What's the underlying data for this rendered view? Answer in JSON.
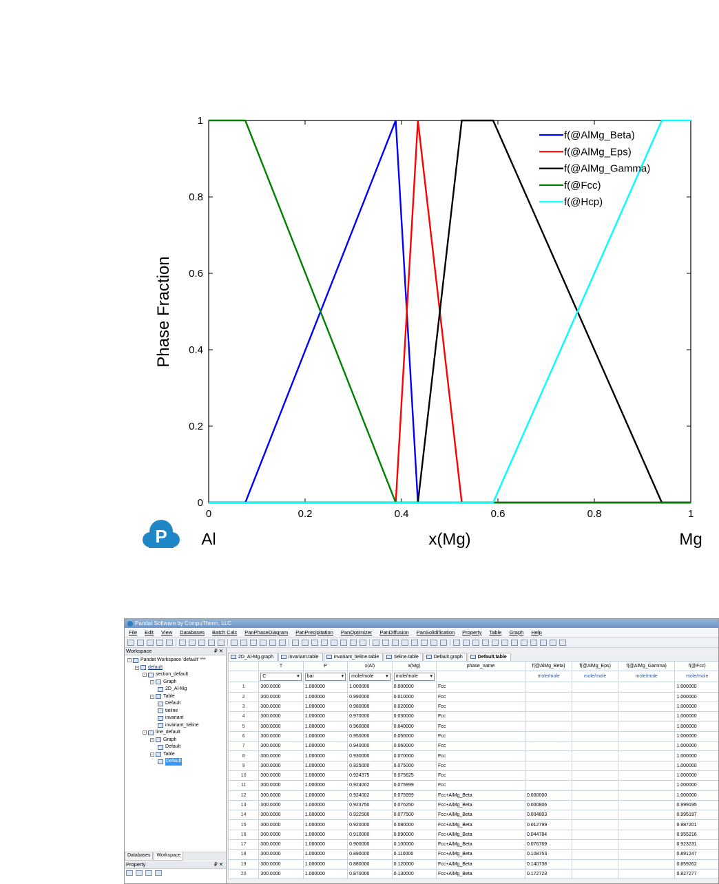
{
  "chart_data": {
    "type": "line",
    "xlabel": "x(Mg)",
    "ylabel": "Phase Fraction",
    "xlim": [
      0,
      1
    ],
    "ylim": [
      0,
      1
    ],
    "x_ticks": [
      "0",
      "0.2",
      "0.4",
      "0.6",
      "0.8",
      "1"
    ],
    "y_ticks": [
      "0",
      "0.2",
      "0.4",
      "0.6",
      "0.8",
      "1"
    ],
    "x_end_labels": {
      "left": "Al",
      "right": "Mg"
    },
    "legend_placement": "top-right",
    "grid": false,
    "series": [
      {
        "name": "f(@AlMg_Beta)",
        "color": "#0000ff",
        "x": [
          0,
          0.076,
          0.388,
          0.434,
          1
        ],
        "y": [
          0,
          0,
          1,
          0,
          0
        ]
      },
      {
        "name": "f(@AlMg_Eps)",
        "color": "#ff0000",
        "x": [
          0,
          0.388,
          0.434,
          0.525,
          1
        ],
        "y": [
          0,
          0,
          1,
          0,
          0
        ]
      },
      {
        "name": "f(@AlMg_Gamma)",
        "color": "#000000",
        "x": [
          0,
          0.434,
          0.525,
          0.59,
          0.94,
          1
        ],
        "y": [
          0,
          0,
          1,
          1,
          0,
          0
        ]
      },
      {
        "name": "f(@Fcc)",
        "color": "#008000",
        "x": [
          0,
          0.076,
          0.388,
          1
        ],
        "y": [
          1,
          1,
          0,
          0
        ]
      },
      {
        "name": "f(@Hcp)",
        "color": "#00ffff",
        "x": [
          0,
          0.59,
          0.94,
          1
        ],
        "y": [
          0,
          0,
          1,
          1
        ]
      }
    ]
  },
  "logo": {
    "letter": "P",
    "color": "#1f87c6"
  },
  "app": {
    "title": "Pandat Software by CompuTherm, LLC",
    "menu": [
      "File",
      "Edit",
      "View",
      "Databases",
      "Batch Calc",
      "PanPhaseDiagram",
      "PanPrecipitation",
      "PanOptimizer",
      "PanDiffusion",
      "PanSolidification",
      "Property",
      "Table",
      "Graph",
      "Help"
    ],
    "workspace_header": "Workspace",
    "pin_glyph": "₽ ✕",
    "tree": [
      {
        "label": "Pandat Workspace 'default' ***",
        "indent": 0,
        "expander": "-"
      },
      {
        "label": "default",
        "indent": 1,
        "expander": "-",
        "link": true
      },
      {
        "label": "section_default",
        "indent": 2,
        "expander": "-"
      },
      {
        "label": "Graph",
        "indent": 3,
        "expander": "-"
      },
      {
        "label": "2D_Al-Mg",
        "indent": 4,
        "expander": ""
      },
      {
        "label": "Table",
        "indent": 3,
        "expander": "-"
      },
      {
        "label": "Default",
        "indent": 4,
        "expander": ""
      },
      {
        "label": "tieline",
        "indent": 4,
        "expander": ""
      },
      {
        "label": "invariant",
        "indent": 4,
        "expander": ""
      },
      {
        "label": "invariant_tieline",
        "indent": 4,
        "expander": ""
      },
      {
        "label": "line_default",
        "indent": 2,
        "expander": "-"
      },
      {
        "label": "Graph",
        "indent": 3,
        "expander": "-"
      },
      {
        "label": "Default",
        "indent": 4,
        "expander": ""
      },
      {
        "label": "Table",
        "indent": 3,
        "expander": "-"
      },
      {
        "label": "Default",
        "indent": 4,
        "expander": "",
        "selected": true
      }
    ],
    "ws_tabs": [
      "Databases",
      "Workspace"
    ],
    "property_header": "Property",
    "doc_tabs": [
      "2D_Al-Mg.graph",
      "invariant.table",
      "invariant_tieline.table",
      "tieline.table",
      "Default.graph",
      "Default.table"
    ],
    "active_doc_tab": 5,
    "columns": [
      "T",
      "P",
      "x(Al)",
      "x(Mg)",
      "phase_name",
      "f(@AlMg_Beta)",
      "f(@AlMg_Eps)",
      "f(@AlMg_Gamma)",
      "f(@Fcc)"
    ],
    "unit_selects": [
      "C",
      "bar",
      "mole/mole",
      "mole/mole"
    ],
    "unit_texts": [
      "",
      "mole/mole",
      "mole/mole",
      "mole/mole",
      "mole/mole"
    ],
    "rows": [
      [
        "1",
        "300.0000",
        "1.000000",
        "1.000000",
        "0.000000",
        "Fcc",
        "",
        "",
        "",
        "1.000000"
      ],
      [
        "2",
        "300.0000",
        "1.000000",
        "0.990000",
        "0.010000",
        "Fcc",
        "",
        "",
        "",
        "1.000000"
      ],
      [
        "3",
        "300.0000",
        "1.000000",
        "0.980000",
        "0.020000",
        "Fcc",
        "",
        "",
        "",
        "1.000000"
      ],
      [
        "4",
        "300.0000",
        "1.000000",
        "0.970000",
        "0.030000",
        "Fcc",
        "",
        "",
        "",
        "1.000000"
      ],
      [
        "5",
        "300.0000",
        "1.000000",
        "0.960000",
        "0.040000",
        "Fcc",
        "",
        "",
        "",
        "1.000000"
      ],
      [
        "6",
        "300.0000",
        "1.000000",
        "0.950000",
        "0.050000",
        "Fcc",
        "",
        "",
        "",
        "1.000000"
      ],
      [
        "7",
        "300.0000",
        "1.000000",
        "0.940000",
        "0.060000",
        "Fcc",
        "",
        "",
        "",
        "1.000000"
      ],
      [
        "8",
        "300.0000",
        "1.000000",
        "0.930000",
        "0.070000",
        "Fcc",
        "",
        "",
        "",
        "1.000000"
      ],
      [
        "9",
        "300.0000",
        "1.000000",
        "0.925000",
        "0.075000",
        "Fcc",
        "",
        "",
        "",
        "1.000000"
      ],
      [
        "10",
        "300.0000",
        "1.000000",
        "0.924375",
        "0.075625",
        "Fcc",
        "",
        "",
        "",
        "1.000000"
      ],
      [
        "11",
        "300.0000",
        "1.000000",
        "0.924002",
        "0.075999",
        "Fcc",
        "",
        "",
        "",
        "1.000000"
      ],
      [
        "12",
        "300.0000",
        "1.000000",
        "0.924002",
        "0.075999",
        "Fcc+AlMg_Beta",
        "0.000000",
        "",
        "",
        "1.000000"
      ],
      [
        "13",
        "300.0000",
        "1.000000",
        "0.923750",
        "0.076250",
        "Fcc+AlMg_Beta",
        "0.000806",
        "",
        "",
        "0.999195"
      ],
      [
        "14",
        "300.0000",
        "1.000000",
        "0.922500",
        "0.077500",
        "Fcc+AlMg_Beta",
        "0.004803",
        "",
        "",
        "0.995197"
      ],
      [
        "15",
        "300.0000",
        "1.000000",
        "0.920000",
        "0.080000",
        "Fcc+AlMg_Beta",
        "0.012799",
        "",
        "",
        "0.987201"
      ],
      [
        "16",
        "300.0000",
        "1.000000",
        "0.910000",
        "0.090000",
        "Fcc+AlMg_Beta",
        "0.044784",
        "",
        "",
        "0.955216"
      ],
      [
        "17",
        "300.0000",
        "1.000000",
        "0.900000",
        "0.100000",
        "Fcc+AlMg_Beta",
        "0.076769",
        "",
        "",
        "0.923231"
      ],
      [
        "18",
        "300.0000",
        "1.000000",
        "0.890000",
        "0.110000",
        "Fcc+AlMg_Beta",
        "0.108753",
        "",
        "",
        "0.891247"
      ],
      [
        "19",
        "300.0000",
        "1.000000",
        "0.880000",
        "0.120000",
        "Fcc+AlMg_Beta",
        "0.140738",
        "",
        "",
        "0.859262"
      ],
      [
        "20",
        "300.0000",
        "1.000000",
        "0.870000",
        "0.130000",
        "Fcc+AlMg_Beta",
        "0.172723",
        "",
        "",
        "0.827277"
      ]
    ]
  }
}
